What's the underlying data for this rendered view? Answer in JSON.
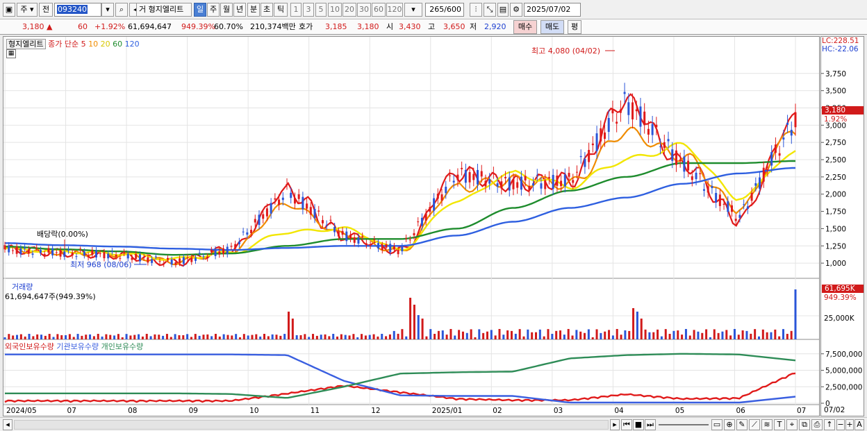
{
  "toolbar": {
    "market": "주",
    "prev": "전",
    "code": "093240",
    "stock_name": "형지엘리트",
    "periods": [
      "일",
      "주",
      "월",
      "년",
      "분",
      "초",
      "틱"
    ],
    "selected_period": "일",
    "minute_options": [
      "1",
      "3",
      "5",
      "10",
      "20",
      "30",
      "60",
      "120"
    ],
    "count": "265",
    "count_total": "/600",
    "date": "2025/07/02"
  },
  "quote": {
    "price": "3,180",
    "arrow": "▲",
    "change": "60",
    "change_pct": "+1.92%",
    "volume": "61,694,647",
    "volume_ratio": "949.39%",
    "turnover": "60.70%",
    "amount": "210,374백만",
    "bid_label": "호가",
    "bid1": "3,185",
    "bid2": "3,180",
    "open_label": "시",
    "open": "3,430",
    "high_label": "고",
    "high": "3,650",
    "low_label": "저",
    "low": "2,920",
    "buy_label": "매수",
    "sell_label": "매도",
    "eval_label": "평"
  },
  "price_panel": {
    "legend_name": "형지엘리트",
    "legend_series": "종가 단순",
    "ma_periods": [
      "5",
      "10",
      "20",
      "60",
      "120"
    ],
    "ma_colors": [
      "#e01a1a",
      "#f08c00",
      "#f2e600",
      "#1e8c2d",
      "#2e5fe0"
    ],
    "lc_label": "LC:228.51",
    "hc_label": "HC:-22.06",
    "price_tag": "3,180",
    "pct_tag": "1.92%",
    "annot_high": "최고 4,080 (04/02)",
    "annot_low": "최저 968 (08/06)",
    "annot_div": "배당락(0.00%)"
  },
  "volume_panel": {
    "title": "거래량",
    "value_text": "61,694,647주(949.39%)",
    "tag": "61,695K",
    "tag_pct": "949.39%",
    "tick": "25,000K"
  },
  "holding_panel": {
    "legend": [
      "외국인보유수량",
      "기관보유수량",
      "개인보유수량"
    ],
    "colors": [
      "#e01a1a",
      "#3a5fe0",
      "#2e8c57"
    ],
    "ticks": [
      "7,500,000",
      "5,000,000",
      "2,500,000",
      "0"
    ]
  },
  "x_labels": [
    "2024/05",
    "07",
    "08",
    "09",
    "10",
    "11",
    "12",
    "2025/01",
    "02",
    "03",
    "04",
    "05",
    "06",
    "07"
  ],
  "x_last_label": "07/02",
  "chart_data": [
    {
      "type": "line",
      "title": "형지엘리트 종가 단순 이동평균",
      "y_ticks": [
        1000,
        1250,
        1500,
        1750,
        2000,
        2250,
        2500,
        2750,
        3000,
        3250,
        3500,
        3750
      ],
      "ylim": [
        800,
        4100
      ],
      "x": [
        "2024/05",
        "06",
        "07",
        "08",
        "09",
        "10",
        "11",
        "12",
        "2025/01",
        "02",
        "03",
        "04",
        "05",
        "06",
        "07/02"
      ],
      "series": [
        {
          "name": "5",
          "values": [
            1200,
            1150,
            1120,
            1010,
            1200,
            2050,
            1400,
            1180,
            2300,
            2150,
            2200,
            3350,
            2450,
            1650,
            3100
          ]
        },
        {
          "name": "10",
          "values": [
            1200,
            1160,
            1130,
            1020,
            1180,
            1850,
            1420,
            1170,
            2100,
            2200,
            2150,
            2900,
            2550,
            1800,
            2950
          ]
        },
        {
          "name": "20",
          "values": [
            1210,
            1170,
            1140,
            1060,
            1150,
            1450,
            1500,
            1200,
            1900,
            2300,
            2120,
            2500,
            2700,
            1950,
            2600
          ]
        },
        {
          "name": "60",
          "values": [
            1240,
            1200,
            1170,
            1120,
            1140,
            1250,
            1350,
            1350,
            1500,
            1800,
            2050,
            2250,
            2450,
            2450,
            2480
          ]
        },
        {
          "name": "120",
          "values": [
            1290,
            1260,
            1240,
            1210,
            1190,
            1220,
            1250,
            1250,
            1400,
            1600,
            1800,
            1950,
            2150,
            2300,
            2380
          ]
        }
      ],
      "annotations": [
        "최고 4,080 (04/02)",
        "최저 968 (08/06)",
        "배당락(0.00%)"
      ],
      "last_price": 3180
    },
    {
      "type": "bar",
      "title": "거래량",
      "ylabel": "",
      "tick": "25,000K",
      "last_value": 61694647
    },
    {
      "type": "line",
      "title": "",
      "ylim": [
        0,
        8000000
      ],
      "x": [
        "2024/05",
        "06",
        "07",
        "08",
        "09",
        "10",
        "11",
        "12",
        "2025/01",
        "02",
        "03",
        "04",
        "05",
        "06",
        "07/02"
      ],
      "series": [
        {
          "name": "외국인보유수량",
          "values": [
            200000,
            200000,
            200000,
            200000,
            200000,
            1300000,
            2500000,
            1500000,
            500000,
            300000,
            300000,
            1200000,
            500000,
            600000,
            4500000
          ]
        },
        {
          "name": "기관보유수량",
          "values": [
            7400000,
            7400000,
            7400000,
            7400000,
            7400000,
            7300000,
            3400000,
            1200000,
            1100000,
            1100000,
            100000,
            100000,
            100000,
            100000,
            1000000
          ]
        },
        {
          "name": "개인보유수량",
          "values": [
            1500000,
            1500000,
            1500000,
            1500000,
            1400000,
            800000,
            2500000,
            4500000,
            4700000,
            4800000,
            6800000,
            7300000,
            7500000,
            7400000,
            6500000
          ]
        }
      ]
    }
  ]
}
